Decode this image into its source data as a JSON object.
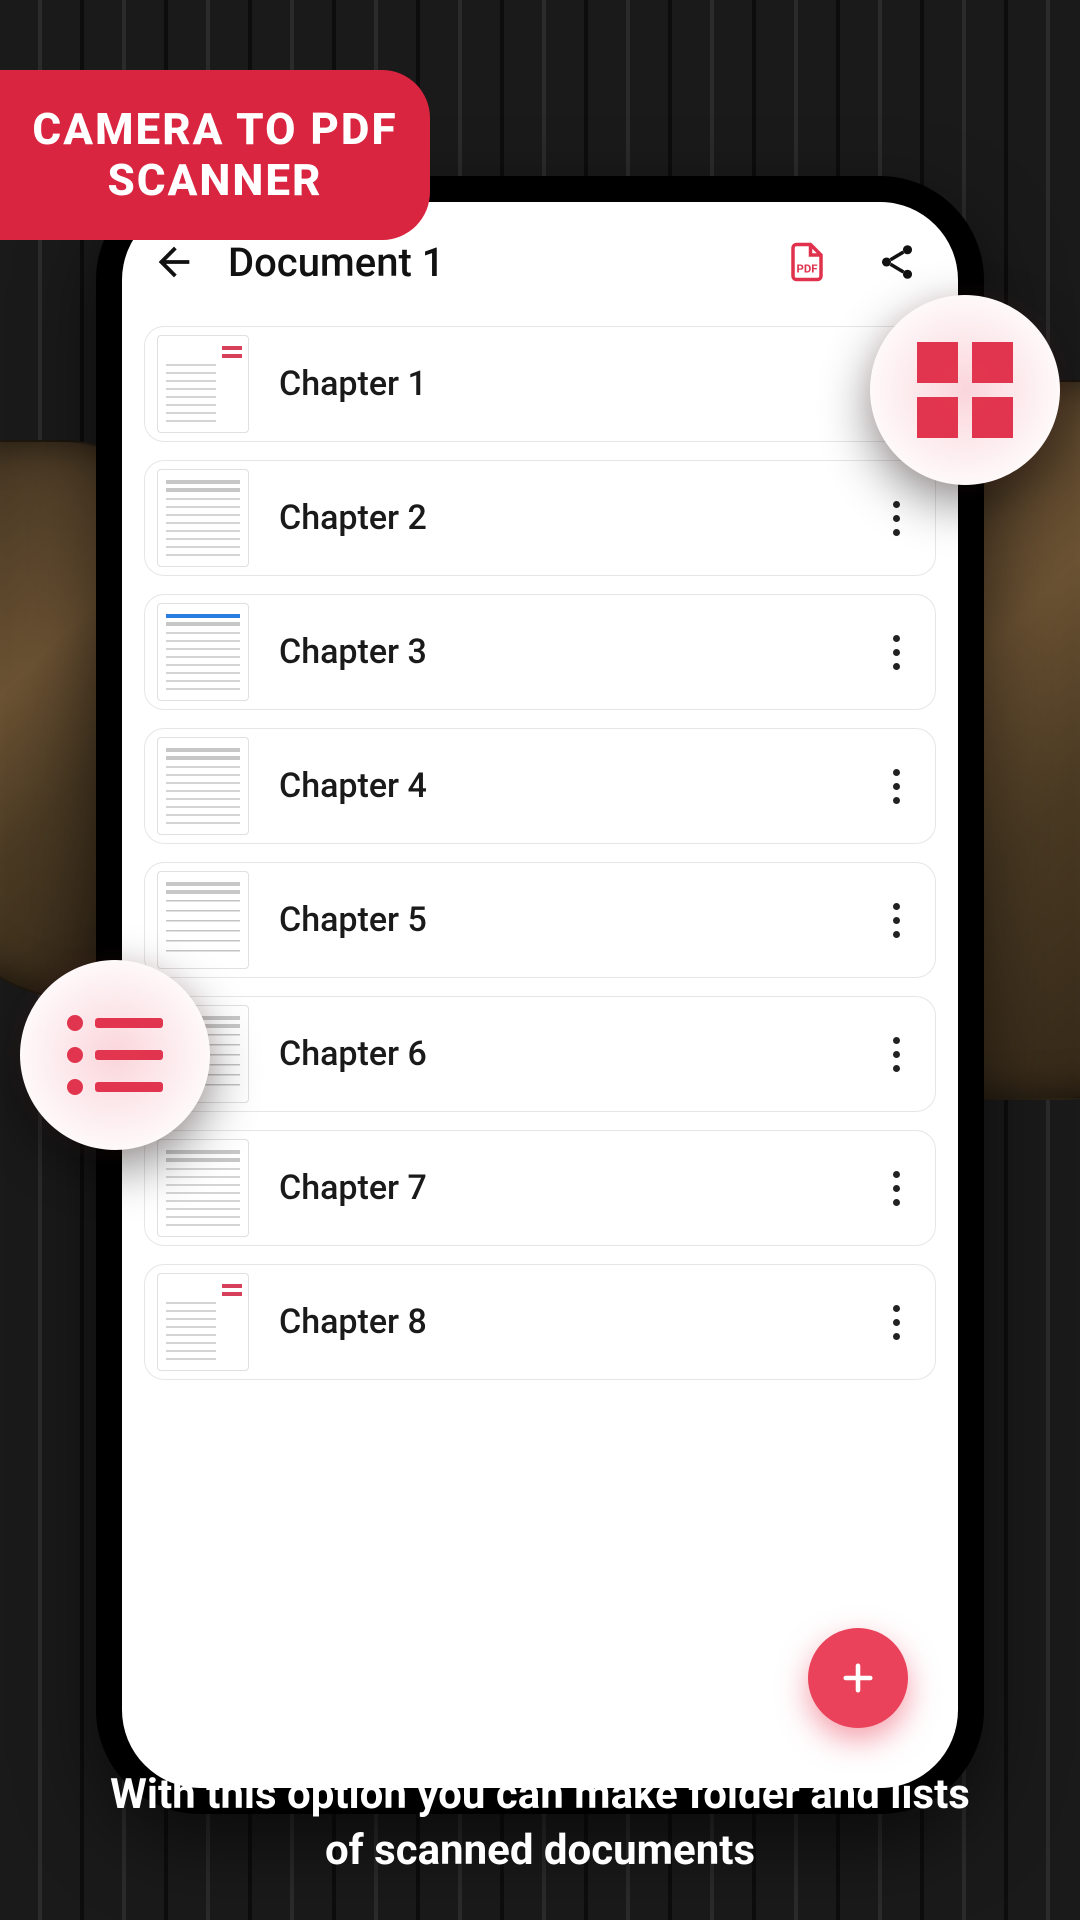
{
  "promo": {
    "line1": "CAMERA TO PDF",
    "line2": "SCANNER"
  },
  "colors": {
    "accent": "#e0324c",
    "banner": "#d92540",
    "fab": "#e9425a"
  },
  "header": {
    "title": "Document 1",
    "pdf_icon_label": "PDF"
  },
  "callouts": {
    "grid_view_name": "grid-view",
    "list_view_name": "list-view"
  },
  "documents": [
    {
      "title": "Chapter 1",
      "thumb_style": "style-d"
    },
    {
      "title": "Chapter 2",
      "thumb_style": ""
    },
    {
      "title": "Chapter 3",
      "thumb_style": "style-b"
    },
    {
      "title": "Chapter 4",
      "thumb_style": ""
    },
    {
      "title": "Chapter 5",
      "thumb_style": "style-c"
    },
    {
      "title": "Chapter 6",
      "thumb_style": "style-c"
    },
    {
      "title": "Chapter 7",
      "thumb_style": ""
    },
    {
      "title": "Chapter 8",
      "thumb_style": "style-d"
    }
  ],
  "caption": {
    "line1": "With this option you can make folder and lists",
    "line2": "of scanned documents"
  }
}
